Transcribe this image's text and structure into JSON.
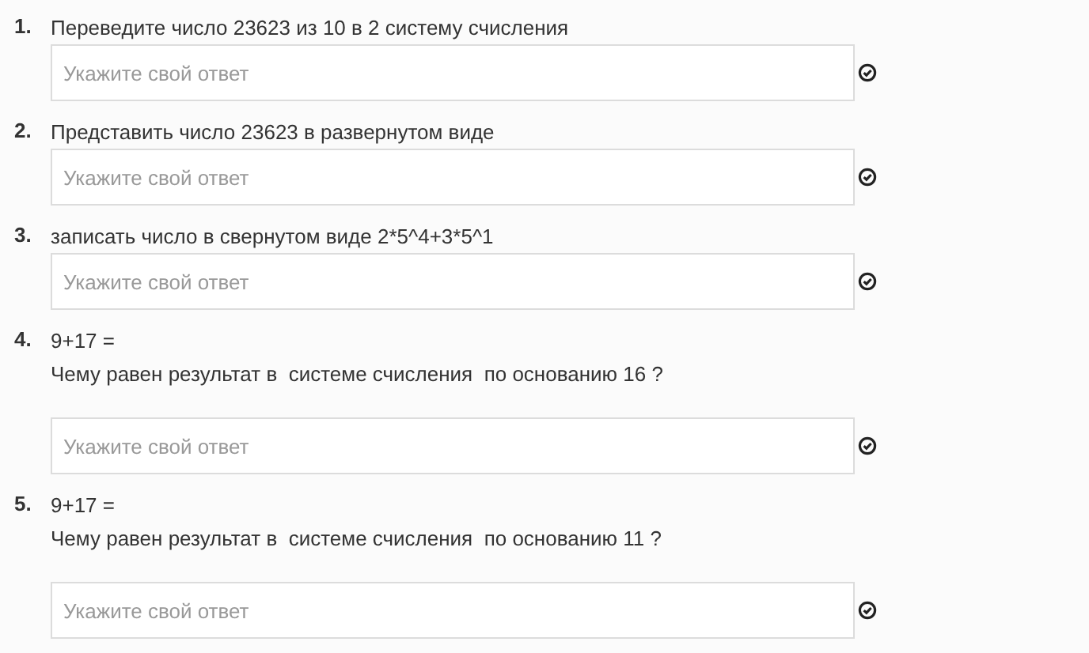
{
  "questions": [
    {
      "number": "1.",
      "lines": [
        "Переведите число 23623 из 10 в 2 систему счисления"
      ],
      "placeholder": "Укажите свой ответ"
    },
    {
      "number": "2.",
      "lines": [
        "Представить число 23623 в развернутом виде"
      ],
      "placeholder": "Укажите свой ответ"
    },
    {
      "number": "3.",
      "lines": [
        "записать число в свернутом виде 2*5^4+3*5^1"
      ],
      "placeholder": "Укажите свой ответ"
    },
    {
      "number": "4.",
      "lines": [
        "9+17 =",
        "Чему равен результат в  системе счисления  по основанию 16 ?"
      ],
      "placeholder": "Укажите свой ответ"
    },
    {
      "number": "5.",
      "lines": [
        "9+17 =",
        "Чему равен результат в  системе счисления  по основанию 11 ?"
      ],
      "placeholder": "Укажите свой ответ"
    }
  ]
}
